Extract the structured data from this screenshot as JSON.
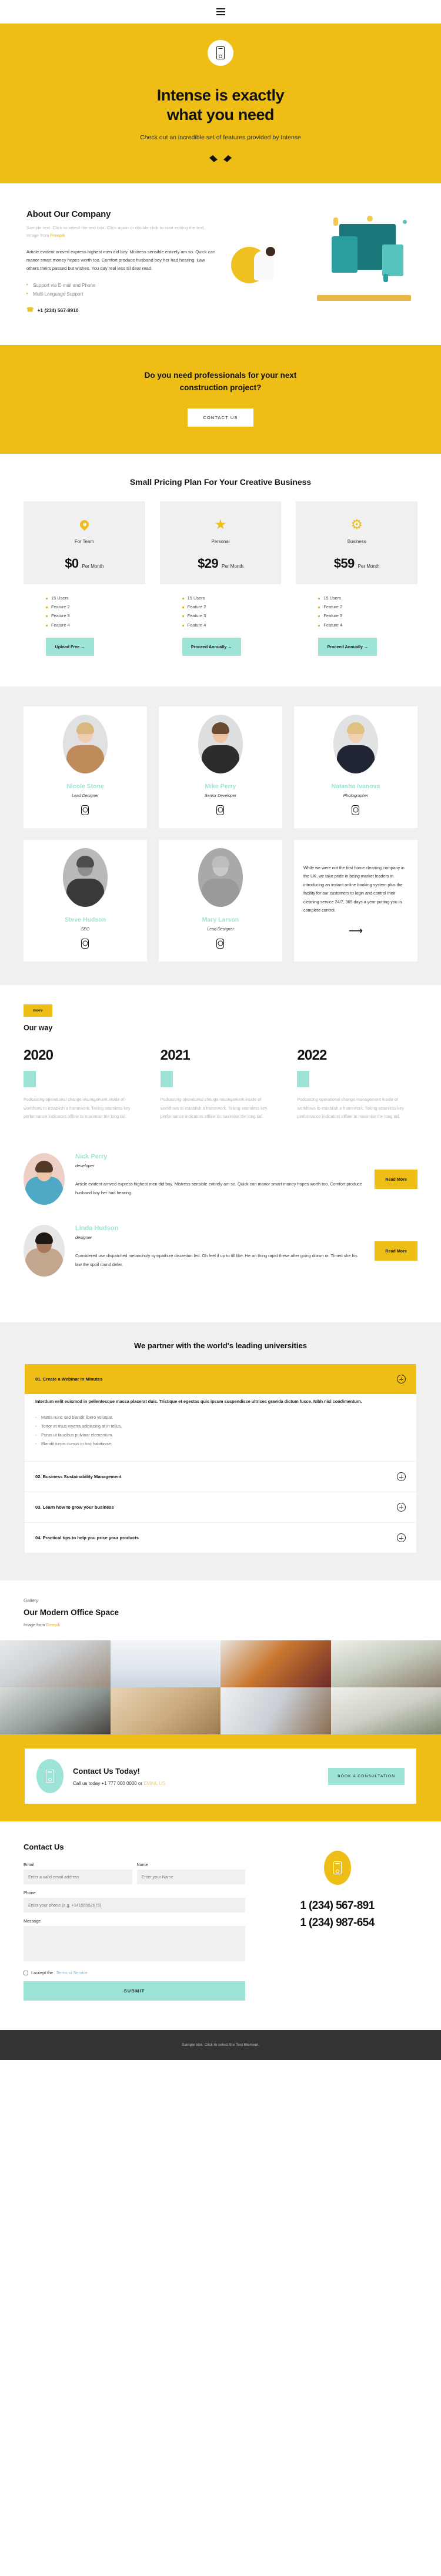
{
  "topbar": {
    "menu_icon": "hamburger-menu-icon"
  },
  "hero": {
    "badge_icon": "mobile-phone-icon",
    "title_line1": "Intense is exactly",
    "title_line2": "what you need",
    "subtitle": "Check out an incredible set of features provided by Intense",
    "scroll_icon": "chevron-down-icon",
    "bg_color": "#eebe16"
  },
  "about": {
    "heading": "About Our Company",
    "note_prefix": "Sample text. Click to select the text box. Click again or double click to start editing the text. Image from ",
    "note_link": "Freepik",
    "body": "Article evident arrived express highest men did boy. Mistress sensible entirely am so. Quick can manor smart money hopes worth too. Comfort produce husband boy her had hearing. Law others theirs passed but wishes. You day real less till dear read.",
    "list": [
      "Support via E-mail and Phone",
      "Multi-Language Support"
    ],
    "phone": "+1 (234) 567-8910",
    "phone_icon": "phone-icon"
  },
  "cta": {
    "title_line1": "Do you need professionals for your next",
    "title_line2": "construction project?",
    "button": "CONTACT US"
  },
  "pricing": {
    "heading": "Small Pricing Plan For Your Creative Business",
    "plans": [
      {
        "icon": "map-pin-icon",
        "name": "For Team",
        "price": "$0",
        "period": "Per Month",
        "features": [
          "15 Users",
          "Feature 2",
          "Feature 3",
          "Feature 4"
        ],
        "button": "Upload Free →"
      },
      {
        "icon": "star-icon",
        "name": "Personal",
        "price": "$29",
        "period": "Per Month",
        "features": [
          "15 Users",
          "Feature 2",
          "Feature 3",
          "Feature 4"
        ],
        "button": "Proceed Annually →"
      },
      {
        "icon": "gear-icon",
        "name": "Business",
        "price": "$59",
        "period": "Per Month",
        "features": [
          "15 Users",
          "Feature 2",
          "Feature 3",
          "Feature 4"
        ],
        "button": "Proceed Annually →"
      }
    ]
  },
  "team": {
    "members": [
      {
        "name": "Nicole Stone",
        "role": "Lead Designer",
        "social_icon": "instagram-icon"
      },
      {
        "name": "Mike Perry",
        "role": "Senior Developer",
        "social_icon": "instagram-icon"
      },
      {
        "name": "Natasha Ivanova",
        "role": "Photographer",
        "social_icon": "instagram-icon"
      },
      {
        "name": "Steve Hudson",
        "role": "SEO",
        "social_icon": "instagram-icon"
      },
      {
        "name": "Mary Larson",
        "role": "Lead Designer",
        "social_icon": "instagram-icon"
      }
    ],
    "quote": "While we were not the first home cleaning company in the UK, we take pride in being market leaders in introducing an instant online booking system plus the facility for our customers to login and control their cleaning service 24/7, 365 days a year putting you in complete control.",
    "quote_arrow_icon": "arrow-right-icon"
  },
  "ourway": {
    "tag": "more",
    "heading": "Our way",
    "items": [
      {
        "year": "2020",
        "text": "Podcasting operational change management inside of workflows to establish a framework. Taking seamless key performance indicators offline to maximise the long tail."
      },
      {
        "year": "2021",
        "text": "Podcasting operational change management inside of workflows to establish a framework. Taking seamless key performance indicators offline to maximise the long tail."
      },
      {
        "year": "2022",
        "text": "Podcasting operational change management inside of workflows to establish a framework. Taking seamless key performance indicators offline to maximise the long tail."
      }
    ]
  },
  "profiles": [
    {
      "name": "Nick Perry",
      "role": "developer",
      "text": "Article evident arrived express highest men did boy. Mistress sensible entirely am so. Quick can manor smart money hopes worth too. Comfort produce husband boy her had hearing.",
      "button": "Read More"
    },
    {
      "name": "Linda Hudson",
      "role": "designer",
      "text": "Considered use dispatched melancholy sympathize discretion led. Oh feel if up to till like. He an thing rapid these after going drawn or. Timed she his law the spoil round defer.",
      "button": "Read More"
    }
  ],
  "partners": {
    "heading": "We partner with the world's leading universities",
    "items": [
      {
        "title": "01. Create a Webinar in Minutes",
        "open": true,
        "lead": "Interdum velit euismod in pellentesque massa placerat duis. Tristique et egestas quis ipsum suspendisse ultrices gravida dictum fusce. Nibh nisl condimentum.",
        "bullets": [
          "Mattis nunc sed blandit libero volutpat.",
          "Tortor at risus viverra adipiscing at in tellus.",
          "Purus ut faucibus pulvinar elementum.",
          "Blandit turpis cursus in hac habitasse."
        ],
        "toggle_icon": "plus-circle-icon"
      },
      {
        "title": "02. Business Sustainability Management",
        "open": false,
        "toggle_icon": "plus-circle-icon"
      },
      {
        "title": "03. Learn how to grow your business",
        "open": false,
        "toggle_icon": "plus-circle-icon"
      },
      {
        "title": "04. Practical tips to help you price your products",
        "open": false,
        "toggle_icon": "plus-circle-icon"
      }
    ]
  },
  "gallery": {
    "eyebrow": "Gallery",
    "heading": "Our Modern Office Space",
    "note_prefix": "Image from ",
    "note_link": "Freepik",
    "images": [
      "bearded-man-at-laptop-in-open-office",
      "two-businessmen-talking-with-charts-on-desk",
      "woman-with-orange-headphones-at-laptop",
      "team-meeting-with-plants-and-laptops",
      "three-colleagues-collaborating-at-laptop",
      "top-down-desk-with-notebook-and-laptop",
      "hands-typing-on-laptop-keyboard",
      "group-of-people-watching-a-laptop"
    ]
  },
  "banner": {
    "icon": "mobile-phone-icon",
    "title": "Contact Us Today!",
    "text_prefix": "Call us today +1 777 000 0000 or ",
    "text_link": "EMAIL US",
    "button": "BOOK A CONSULTATION"
  },
  "contact": {
    "heading": "Contact Us",
    "email_label": "Email",
    "email_placeholder": "Enter a valid email address",
    "name_label": "Name",
    "name_placeholder": "Enter your Name",
    "phone_label": "Phone",
    "phone_placeholder": "Enter your phone (e.g. +14155552675)",
    "message_label": "Message",
    "message_placeholder": "",
    "terms_prefix": "I accept the ",
    "terms_link": "Terms of Service",
    "submit": "SUBMIT",
    "side_icon": "mobile-phone-icon",
    "phone1": "1 (234) 567-891",
    "phone2": "1 (234) 987-654"
  },
  "footer": {
    "text": "Sample text. Click to select the Text Element."
  }
}
